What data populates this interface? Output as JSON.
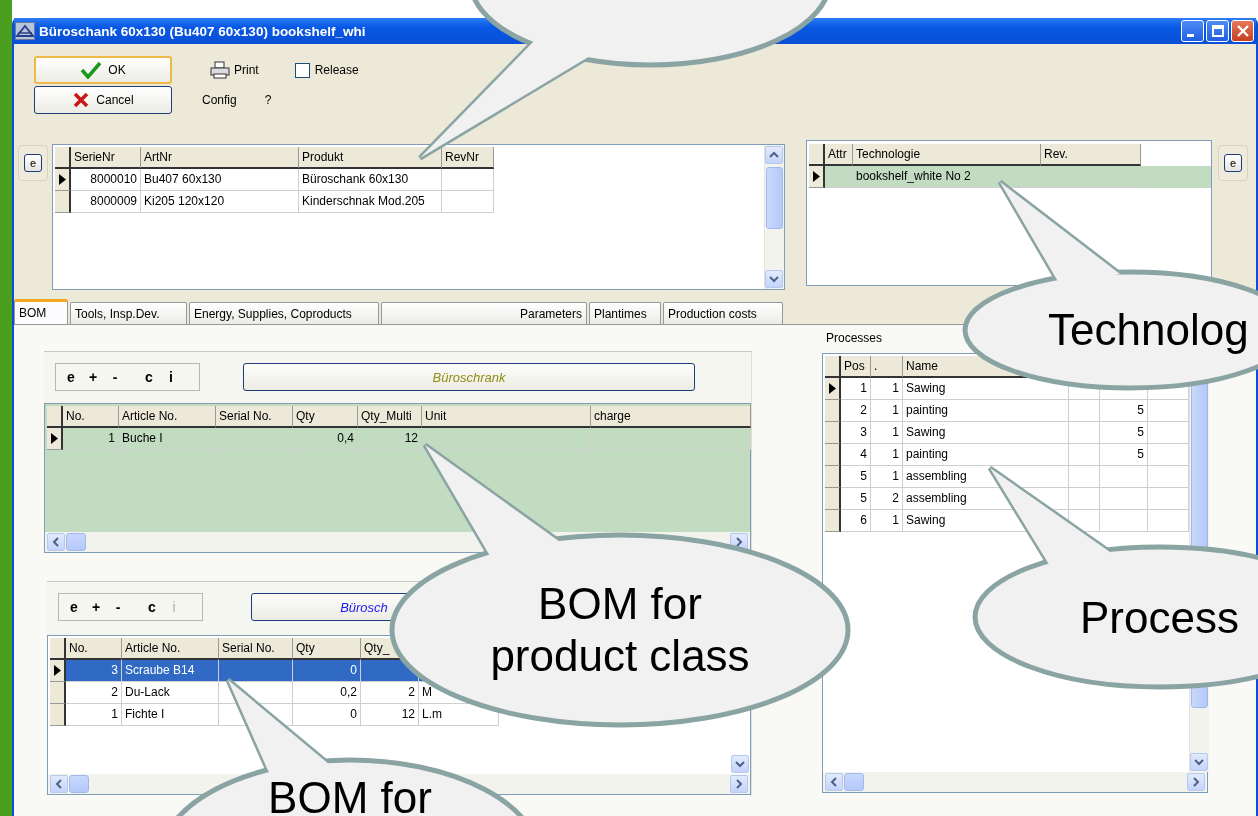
{
  "window": {
    "title": "Büroschank 60x130 (Bu407 60x130) bookshelf_whi"
  },
  "toolbar": {
    "ok": "OK",
    "cancel": "Cancel",
    "print": "Print",
    "release": {
      "label": "Release",
      "checked": false
    },
    "config": "Config",
    "help": "?"
  },
  "side_buttons": [
    "e",
    "e"
  ],
  "products": {
    "columns": [
      "SerieNr",
      "ArtNr",
      "Produkt",
      "RevNr"
    ],
    "rows": [
      {
        "cells": [
          "8000010",
          "Bu407 60x130",
          "Büroschank 60x130",
          null
        ],
        "current": true
      },
      {
        "cells": [
          "8000009",
          "Ki205 120x120",
          "Kinderschnak Mod.205",
          null
        ],
        "current": false
      }
    ]
  },
  "technology": {
    "columns": [
      "Attr",
      "Technologie",
      "Rev."
    ],
    "rows": [
      {
        "cells": [
          null,
          "bookshelf_white No 2",
          null
        ],
        "current": true,
        "selected": true
      }
    ]
  },
  "tabs": [
    {
      "label": "BOM",
      "selected": true
    },
    {
      "label": "Tools, Insp.Dev.",
      "selected": false
    },
    {
      "label": "Energy, Supplies, Coproducts",
      "selected": false
    },
    {
      "label": "Parameters",
      "selected": false
    },
    {
      "label": "Plantimes",
      "selected": false
    },
    {
      "label": "Production costs",
      "selected": false
    }
  ],
  "bom_panels": [
    {
      "tools": [
        {
          "label": "e",
          "disabled": false
        },
        {
          "label": "+",
          "disabled": false
        },
        {
          "label": "-",
          "disabled": false
        },
        {
          "label": "c",
          "disabled": false
        },
        {
          "label": "i",
          "disabled": false
        }
      ],
      "title": "Büroschrank",
      "color": "#8c8c14",
      "active": true,
      "grid": {
        "columns": [
          "No.",
          "Article No.",
          "Serial No.",
          "Qty",
          "Qty_Multi",
          "Unit",
          "charge"
        ],
        "rows": [
          {
            "cells": [
              "1",
              "Buche I",
              null,
              "0,4",
              "12",
              null,
              null
            ],
            "current": true
          }
        ]
      }
    },
    {
      "tools": [
        {
          "label": "e",
          "disabled": false
        },
        {
          "label": "+",
          "disabled": false
        },
        {
          "label": "-",
          "disabled": false
        },
        {
          "label": "c",
          "disabled": false
        },
        {
          "label": "i",
          "disabled": true
        }
      ],
      "title": "Bürosch",
      "color": "#1a1af0",
      "active": false,
      "grid": {
        "columns": [
          "No.",
          "Article No.",
          "Serial No.",
          "Qty",
          "Qty_",
          null
        ],
        "rows": [
          {
            "cells": [
              "3",
              "Scraube B14",
              null,
              "0",
              null,
              null
            ],
            "current": true,
            "selected": true
          },
          {
            "cells": [
              "2",
              "Du-Lack",
              null,
              "0,2",
              "2",
              "M"
            ],
            "current": false,
            "selected": false
          },
          {
            "cells": [
              "1",
              "Fichte I",
              null,
              "0",
              "12",
              "L.m"
            ],
            "current": false,
            "selected": false
          }
        ]
      }
    }
  ],
  "processes": {
    "label": "Processes",
    "columns": [
      "Pos",
      ".",
      "Name",
      null,
      null,
      null
    ],
    "rows": [
      {
        "cells": [
          "1",
          "1",
          "Sawing",
          null,
          null,
          null
        ],
        "current": true
      },
      {
        "cells": [
          "2",
          "1",
          "painting",
          null,
          "5",
          null
        ],
        "current": false
      },
      {
        "cells": [
          "3",
          "1",
          "Sawing",
          null,
          "5",
          null
        ],
        "current": false
      },
      {
        "cells": [
          "4",
          "1",
          "painting",
          null,
          "5",
          null
        ],
        "current": false
      },
      {
        "cells": [
          "5",
          "1",
          "assembling",
          null,
          null,
          null
        ],
        "current": false
      },
      {
        "cells": [
          "5",
          "2",
          "assembling",
          null,
          null,
          null
        ],
        "current": false
      },
      {
        "cells": [
          "6",
          "1",
          "Sawing",
          null,
          null,
          null
        ],
        "current": false
      }
    ]
  },
  "callouts": [
    {
      "kind": "speech"
    },
    {
      "kind": "speech",
      "text": "Technolog"
    },
    {
      "kind": "speech",
      "text": "BOM for product class"
    },
    {
      "kind": "speech",
      "text": "Process"
    },
    {
      "kind": "speech",
      "text": "BOM for"
    }
  ]
}
